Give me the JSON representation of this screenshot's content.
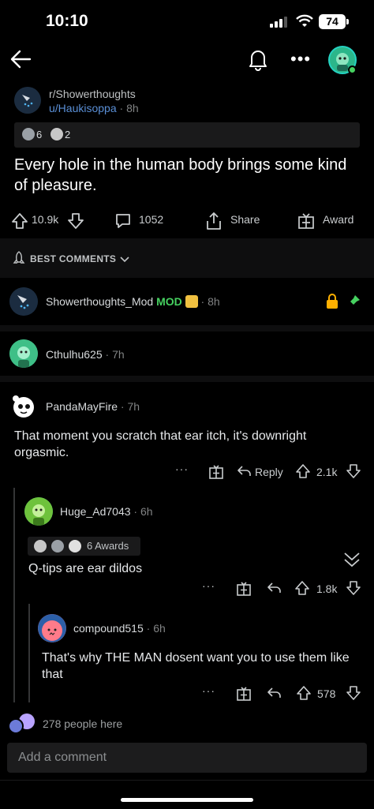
{
  "status": {
    "time": "10:10",
    "battery": "74"
  },
  "post": {
    "subreddit": "r/Showerthoughts",
    "user": "u/Haukisoppa",
    "age": "8h",
    "award_count_1": "6",
    "award_count_2": "2",
    "title": "Every hole in the human body brings some kind of pleasure.",
    "votes": "10.9k",
    "comments": "1052",
    "share_label": "Share",
    "award_label": "Award"
  },
  "sort_label": "BEST COMMENTS",
  "comments": [
    {
      "user": "Showerthoughts_Mod",
      "badge": "MOD",
      "age": "8h"
    },
    {
      "user": "Cthulhu625",
      "age": "7h"
    },
    {
      "user": "PandaMayFire",
      "age": "7h",
      "text": "That moment you scratch that ear itch, it's downright orgasmic.",
      "reply_label": "Reply",
      "votes": "2.1k"
    },
    {
      "user": "Huge_Ad7043",
      "age": "6h",
      "awards": "6 Awards",
      "text": "Q-tips are ear dildos",
      "votes": "1.8k"
    },
    {
      "user": "compound515",
      "age": "6h",
      "text": "That's why THE MAN dosent want you to use them like that",
      "votes": "578"
    }
  ],
  "people_here": "278 people here",
  "comment_placeholder": "Add a comment",
  "colors": {
    "bg": "#000000",
    "mod_green": "#46d160",
    "link_blue": "#5a8fd6",
    "lock_orange": "#ffb000"
  }
}
